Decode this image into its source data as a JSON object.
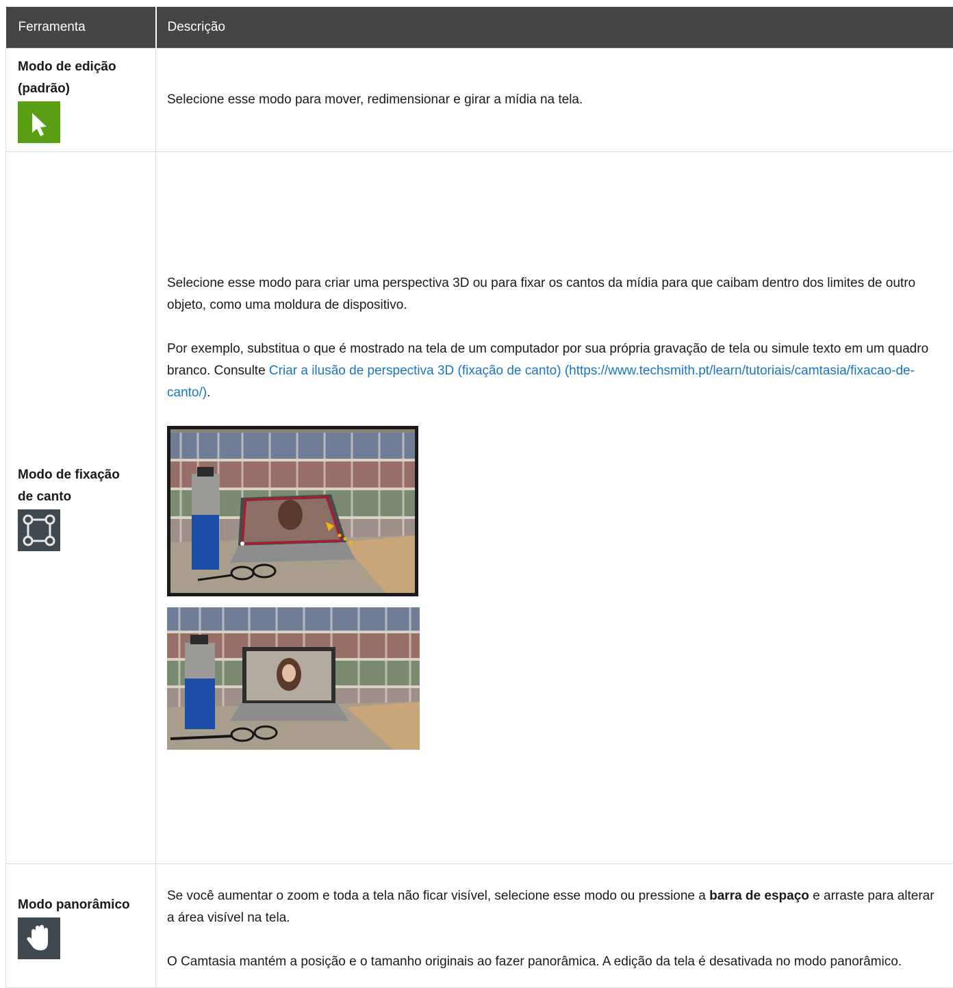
{
  "table": {
    "headers": [
      "Ferramenta",
      "Descrição"
    ],
    "rows": [
      {
        "tool": "Modo de edição (padrão)",
        "icon": "cursor-arrow-icon",
        "description": "Selecione esse modo para mover, redimensionar e girar a mídia na tela."
      },
      {
        "tool": "Modo de fixação de canto",
        "icon": "corner-pin-icon",
        "paragraph1": "Selecione esse modo para criar uma perspectiva 3D ou para fixar os cantos da mídia para que caibam dentro dos limites de outro objeto, como uma moldura de dispositivo.",
        "paragraph2_before": "Por exemplo, substitua o que é mostrado na tela de um computador por sua própria gravação de tela ou simule texto em um quadro branco. Consulte ",
        "link_text": "Criar a ilusão de perspectiva 3D (fixação de canto) (https://www.techsmith.pt/learn/tutoriais/camtasia/fixacao-de-canto/)",
        "paragraph2_after": "."
      },
      {
        "tool": "Modo panorâmico",
        "icon": "hand-pan-icon",
        "paragraph1_before": "Se você aumentar o zoom e toda a tela não ficar visível, selecione esse modo ou pressione a ",
        "paragraph1_bold": "barra de espaço",
        "paragraph1_after": " e arraste para alterar a área visível na tela.",
        "paragraph2": "O Camtasia mantém a posição e o tamanho originais ao fazer panorâmica. A edição da tela é desativada no modo panorâmico."
      }
    ]
  },
  "colors": {
    "header_bg": "#454545",
    "link": "#1a74c4",
    "edit_icon_bg": "#5a9e13",
    "dark_icon_bg": "#404850"
  }
}
